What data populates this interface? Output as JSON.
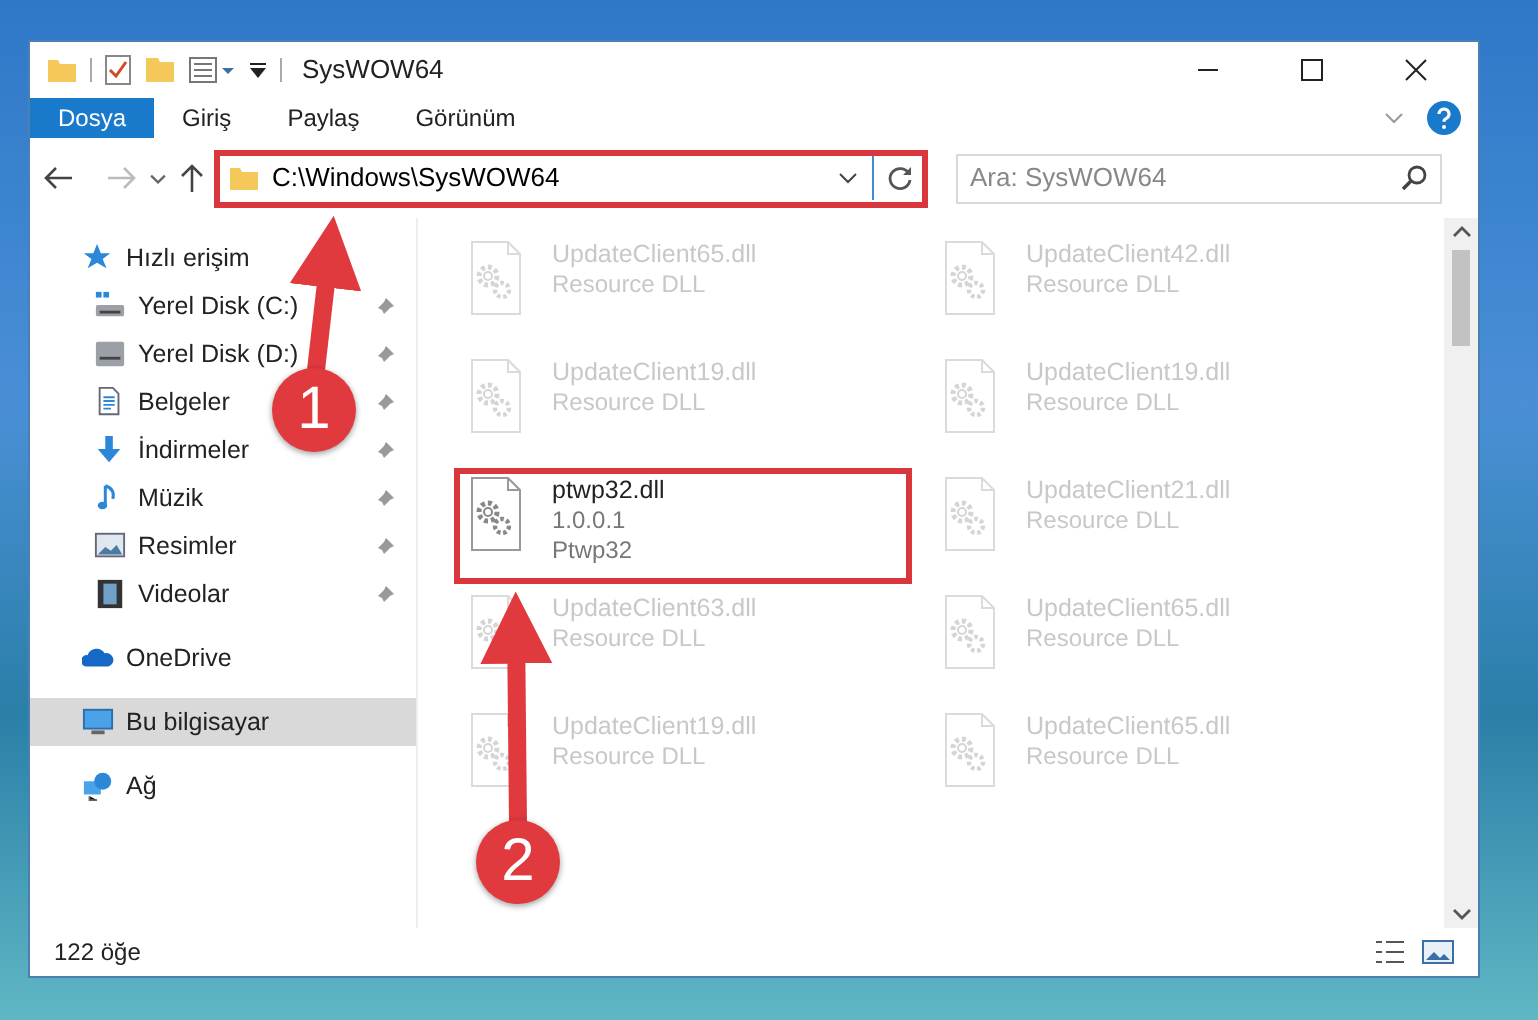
{
  "window": {
    "title": "SysWOW64"
  },
  "ribbon_tabs": [
    {
      "label": "Dosya",
      "selected": true
    },
    {
      "label": "Giriş",
      "selected": false
    },
    {
      "label": "Paylaş",
      "selected": false
    },
    {
      "label": "Görünüm",
      "selected": false
    }
  ],
  "address_bar": {
    "path": "C:\\Windows\\SysWOW64",
    "highlighted": true
  },
  "search": {
    "placeholder": "Ara: SysWOW64"
  },
  "sidebar": {
    "items": [
      {
        "label": "Hızlı erişim",
        "kind": "star",
        "selected": false,
        "children": [
          {
            "label": "Yerel Disk (C:)",
            "kind": "drive-c",
            "pinned": true,
            "selected": false
          },
          {
            "label": "Yerel Disk (D:)",
            "kind": "drive",
            "pinned": true,
            "selected": false
          },
          {
            "label": "Belgeler",
            "kind": "docs",
            "pinned": true,
            "selected": false
          },
          {
            "label": "İndirmeler",
            "kind": "download",
            "pinned": true,
            "selected": false
          },
          {
            "label": "Müzik",
            "kind": "music",
            "pinned": true,
            "selected": false
          },
          {
            "label": "Resimler",
            "kind": "pictures",
            "pinned": true,
            "selected": false
          },
          {
            "label": "Videolar",
            "kind": "video",
            "pinned": true,
            "selected": false
          }
        ]
      },
      {
        "label": "OneDrive",
        "kind": "cloud",
        "selected": false
      },
      {
        "label": "Bu bilgisayar",
        "kind": "pc",
        "selected": true
      },
      {
        "label": "Ağ",
        "kind": "network",
        "selected": false
      }
    ]
  },
  "files": [
    {
      "name": "UpdateClient65.dll",
      "details": [
        "Resource DLL"
      ],
      "dimmed": true,
      "highlighted": false
    },
    {
      "name": "UpdateClient42.dll",
      "details": [
        "Resource DLL"
      ],
      "dimmed": true,
      "highlighted": false
    },
    {
      "name": "UpdateClient19.dll",
      "details": [
        "Resource DLL"
      ],
      "dimmed": true,
      "highlighted": false
    },
    {
      "name": "UpdateClient19.dll",
      "details": [
        "Resource DLL"
      ],
      "dimmed": true,
      "highlighted": false
    },
    {
      "name": "ptwp32.dll",
      "details": [
        "1.0.0.1",
        "Ptwp32"
      ],
      "dimmed": false,
      "highlighted": true
    },
    {
      "name": "UpdateClient21.dll",
      "details": [
        "Resource DLL"
      ],
      "dimmed": true,
      "highlighted": false
    },
    {
      "name": "UpdateClient63.dll",
      "details": [
        "Resource DLL"
      ],
      "dimmed": true,
      "highlighted": false
    },
    {
      "name": "UpdateClient65.dll",
      "details": [
        "Resource DLL"
      ],
      "dimmed": true,
      "highlighted": false
    },
    {
      "name": "UpdateClient19.dll",
      "details": [
        "Resource DLL"
      ],
      "dimmed": true,
      "highlighted": false
    },
    {
      "name": "UpdateClient65.dll",
      "details": [
        "Resource DLL"
      ],
      "dimmed": true,
      "highlighted": false
    }
  ],
  "status_bar": {
    "count": "122 öğe"
  },
  "callouts": [
    {
      "number": "1"
    },
    {
      "number": "2"
    }
  ]
}
